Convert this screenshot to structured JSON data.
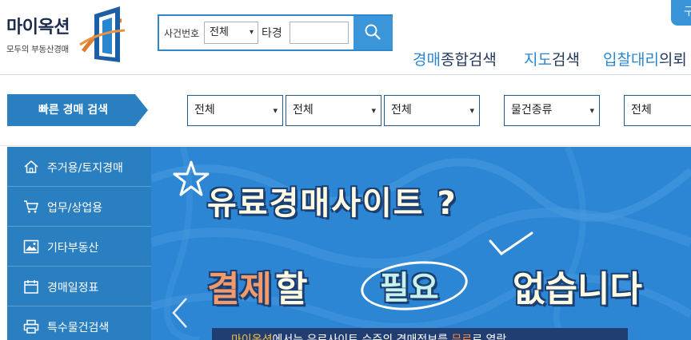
{
  "logo": {
    "title": "마이옥션",
    "subtitle": "모두의 부동산경매"
  },
  "search": {
    "case_label": "사건번호",
    "select_value": "전체",
    "other_label": "타경",
    "input_value": "",
    "button_icon": "search-icon"
  },
  "nav": {
    "item1": {
      "hl": "경매",
      "rest": "종합검색"
    },
    "item2": {
      "hl": "지도",
      "rest": "검색"
    },
    "item3": {
      "hl": "입찰대리",
      "rest": "의뢰"
    }
  },
  "corner_tab": {
    "label": "구"
  },
  "quick_search": {
    "label": "빠른 경매 검색",
    "selects": [
      "전체",
      "전체",
      "전체",
      "물건종류",
      "전체"
    ]
  },
  "sidebar": {
    "items": [
      {
        "label": "주거용/토지경매",
        "icon": "home-icon"
      },
      {
        "label": "업무/상업용",
        "icon": "cart-icon"
      },
      {
        "label": "기타부동산",
        "icon": "image-icon"
      },
      {
        "label": "경매일정표",
        "icon": "calendar-icon"
      },
      {
        "label": "특수물건검색",
        "icon": "printer-icon"
      }
    ]
  },
  "banner": {
    "title_line1": "유료경매사이트 ?",
    "title_line2_part1": "결제",
    "title_line2_part2": "할",
    "title_line2_part3": "필요",
    "title_line2_part4": "없습니다",
    "strip_part1": "마이옥션",
    "strip_part2": "에서는 유료사이트 수준의 경매정보를 ",
    "strip_part3": "무료",
    "strip_part4": "로 열람",
    "colors": {
      "background": "#2c86d4",
      "accent_orange": "#f29a6b",
      "strip": "#203e72"
    }
  },
  "colors": {
    "brand_blue": "#2a7fc1",
    "nav_highlight": "#2a87cf",
    "search_button": "#3b95d9"
  }
}
